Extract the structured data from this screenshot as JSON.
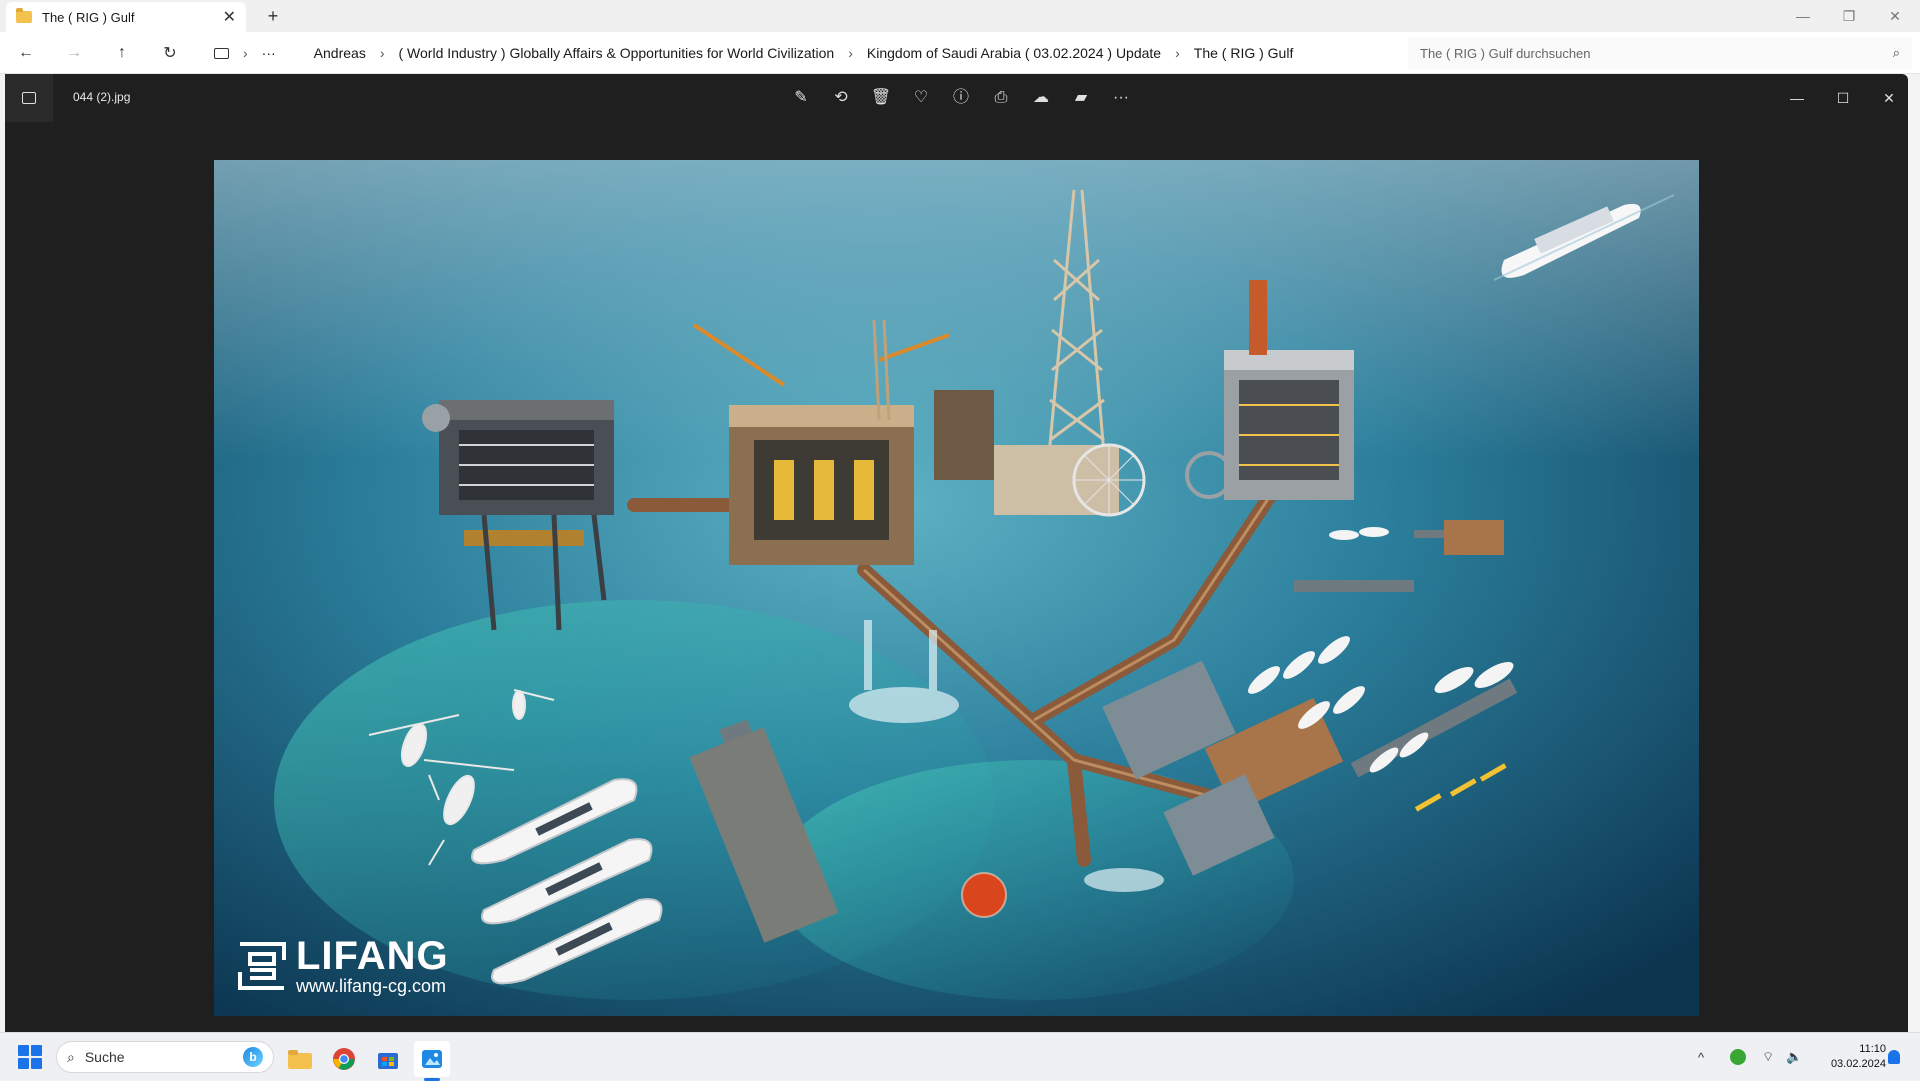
{
  "explorer": {
    "tab_title": "The ( RIG ) Gulf",
    "tab_close": "✕",
    "new_tab": "+",
    "window_controls": {
      "minimize": "—",
      "maximize": "❐",
      "close": "✕"
    },
    "nav": {
      "back": "←",
      "forward": "→",
      "up": "↑",
      "refresh": "↻",
      "more": "···"
    },
    "breadcrumb": [
      "Andreas",
      "( World Industry ) Globally Affairs & Opportunities for World Civilization",
      "Kingdom of Saudi Arabia ( 03.02.2024 ) Update",
      "The ( RIG ) Gulf"
    ],
    "breadcrumb_sep": "›",
    "search_placeholder": "The ( RIG ) Gulf durchsuchen",
    "search_icon": "⌕"
  },
  "viewer": {
    "filename": "044 (2).jpg",
    "toolbar": [
      {
        "name": "edit-image-icon",
        "glyph": "✎"
      },
      {
        "name": "rotate-icon",
        "glyph": "⟲"
      },
      {
        "name": "delete-icon",
        "glyph": "🗑"
      },
      {
        "name": "favorite-icon",
        "glyph": "♡"
      },
      {
        "name": "info-icon",
        "glyph": "ⓘ"
      },
      {
        "name": "print-icon",
        "glyph": "⎙"
      },
      {
        "name": "onedrive-icon",
        "glyph": "☁"
      },
      {
        "name": "clipchamp-icon",
        "glyph": "▰"
      },
      {
        "name": "more-options-icon",
        "glyph": "···"
      }
    ],
    "window_controls": {
      "minimize": "—",
      "maximize": "☐",
      "close": "✕"
    },
    "watermark": {
      "name": "LIFANG",
      "url": "www.lifang-cg.com"
    }
  },
  "taskbar": {
    "search_label": "Suche",
    "search_icon": "⌕",
    "bing_letter": "b",
    "tray_chevron": "^",
    "wifi_icon": "⌔",
    "volume_icon": "🔈",
    "time": "11:10",
    "date": "03.02.2024"
  },
  "colors": {
    "accent": "#1a73e8",
    "viewer_bg": "#1f1f1f",
    "sea_light": "#4aa0b8",
    "sea_dark": "#0c3550"
  }
}
